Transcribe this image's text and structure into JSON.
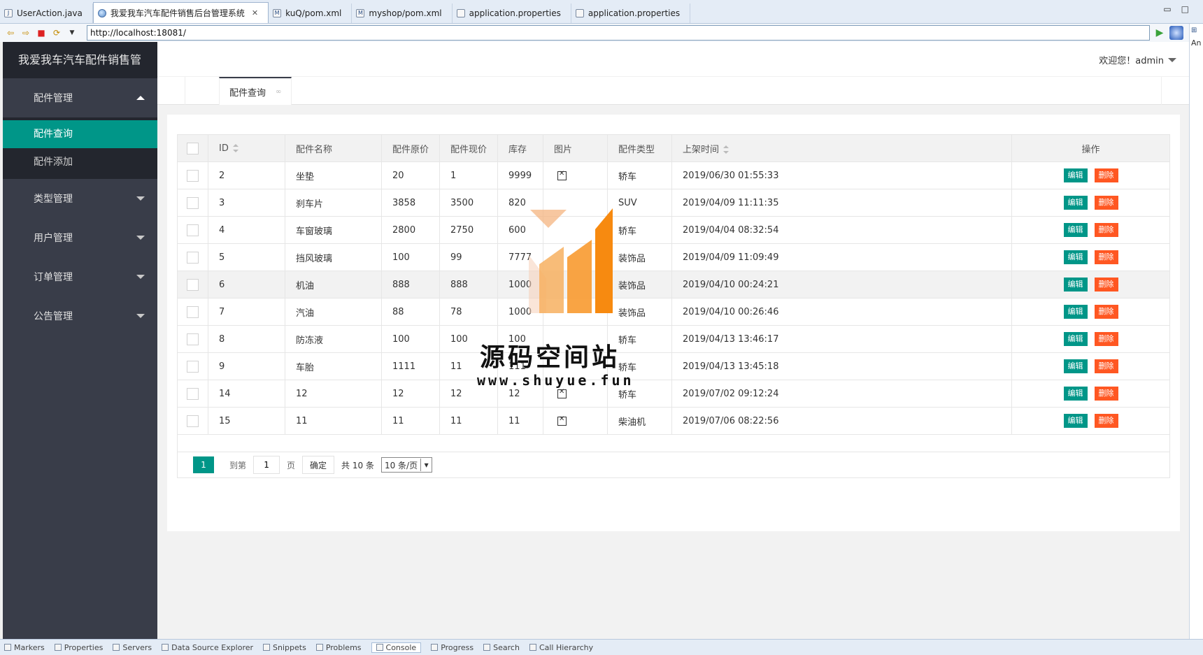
{
  "ide": {
    "tabs": [
      {
        "label": "UserAction.java",
        "icon": "java-file-icon"
      },
      {
        "label": "我爱我车汽车配件销售后台管理系统",
        "icon": "browser-globe-icon",
        "active": true
      },
      {
        "label": "kuQ/pom.xml",
        "icon": "maven-file-icon"
      },
      {
        "label": "myshop/pom.xml",
        "icon": "maven-file-icon"
      },
      {
        "label": "application.properties",
        "icon": "properties-file-icon"
      },
      {
        "label": "application.properties",
        "icon": "properties-file-icon"
      }
    ],
    "url": "http://localhost:18081/",
    "side_label": "An",
    "bottom_tabs": [
      "Markers",
      "Properties",
      "Servers",
      "Data Source Explorer",
      "Snippets",
      "Problems",
      "Console",
      "Progress",
      "Search",
      "Call Hierarchy"
    ],
    "bottom_active": "Console"
  },
  "app": {
    "logo": "我爱我车汽车配件销售管",
    "welcome": "欢迎您！admin",
    "menu": [
      {
        "label": "配件管理",
        "expanded": true,
        "children": [
          {
            "label": "配件查询",
            "active": true
          },
          {
            "label": "配件添加"
          }
        ]
      },
      {
        "label": "类型管理"
      },
      {
        "label": "用户管理"
      },
      {
        "label": "订单管理"
      },
      {
        "label": "公告管理"
      }
    ],
    "page_tab": "配件查询"
  },
  "table": {
    "headers": {
      "id": "ID",
      "name": "配件名称",
      "orig_price": "配件原价",
      "price": "配件现价",
      "stock": "库存",
      "image": "图片",
      "type": "配件类型",
      "time": "上架时间",
      "op": "操作"
    },
    "edit_label": "编辑",
    "delete_label": "删除",
    "rows": [
      {
        "id": "2",
        "name": "坐垫",
        "orig_price": "20",
        "price": "1",
        "stock": "9999",
        "image": true,
        "type": "轿车",
        "time": "2019/06/30 01:55:33"
      },
      {
        "id": "3",
        "name": "刹车片",
        "orig_price": "3858",
        "price": "3500",
        "stock": "820",
        "image": false,
        "type": "SUV",
        "time": "2019/04/09 11:11:35"
      },
      {
        "id": "4",
        "name": "车窗玻璃",
        "orig_price": "2800",
        "price": "2750",
        "stock": "600",
        "image": false,
        "type": "轿车",
        "time": "2019/04/04 08:32:54"
      },
      {
        "id": "5",
        "name": "挡风玻璃",
        "orig_price": "100",
        "price": "99",
        "stock": "7777",
        "image": false,
        "type": "装饰品",
        "time": "2019/04/09 11:09:49"
      },
      {
        "id": "6",
        "name": "机油",
        "orig_price": "888",
        "price": "888",
        "stock": "1000",
        "image": false,
        "type": "装饰品",
        "time": "2019/04/10 00:24:21"
      },
      {
        "id": "7",
        "name": "汽油",
        "orig_price": "88",
        "price": "78",
        "stock": "1000",
        "image": false,
        "type": "装饰品",
        "time": "2019/04/10 00:26:46"
      },
      {
        "id": "8",
        "name": "防冻液",
        "orig_price": "100",
        "price": "100",
        "stock": "100",
        "image": false,
        "type": "轿车",
        "time": "2019/04/13 13:46:17"
      },
      {
        "id": "9",
        "name": "车胎",
        "orig_price": "1111",
        "price": "11",
        "stock": "111",
        "image": false,
        "type": "轿车",
        "time": "2019/04/13 13:45:18"
      },
      {
        "id": "14",
        "name": "12",
        "orig_price": "12",
        "price": "12",
        "stock": "12",
        "image": true,
        "type": "轿车",
        "time": "2019/07/02 09:12:24"
      },
      {
        "id": "15",
        "name": "11",
        "orig_price": "11",
        "price": "11",
        "stock": "11",
        "image": true,
        "type": "柴油机",
        "time": "2019/07/06 08:22:56"
      }
    ]
  },
  "pager": {
    "current": "1",
    "goto_label": "到第",
    "goto_value": "1",
    "page_label": "页",
    "confirm": "确定",
    "total": "共 10 条",
    "per_page": "10 条/页"
  },
  "watermark": {
    "title": "源码空间站",
    "url": "www.shuyue.fun"
  },
  "colors": {
    "sidebar": "#393d49",
    "accent": "#009688",
    "danger": "#ff5722"
  }
}
